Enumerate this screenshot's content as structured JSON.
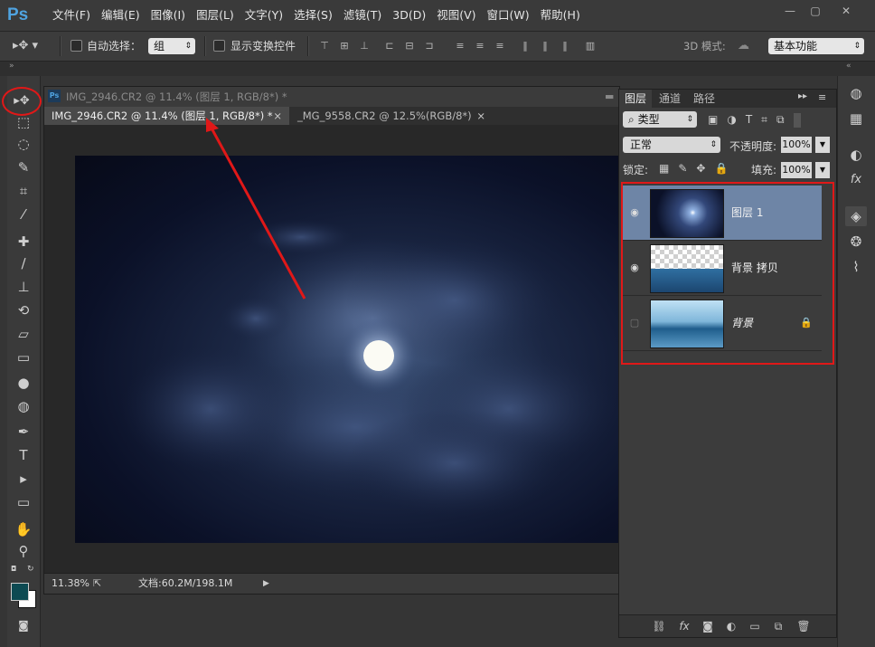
{
  "app": {
    "logo": "Ps"
  },
  "menu": [
    "文件(F)",
    "编辑(E)",
    "图像(I)",
    "图层(L)",
    "文字(Y)",
    "选择(S)",
    "滤镜(T)",
    "3D(D)",
    "视图(V)",
    "窗口(W)",
    "帮助(H)"
  ],
  "window_controls": {
    "minimize": "—",
    "maximize": "▢",
    "close": "✕"
  },
  "options": {
    "auto_select_label": "自动选择：",
    "auto_select_value": "组",
    "show_transform_label": "显示变换控件",
    "mode_3d_label": "3D 模式:",
    "workspace_value": "基本功能"
  },
  "document": {
    "window_title": "IMG_2946.CR2 @ 11.4% (图层 1, RGB/8*) *",
    "tabs": [
      {
        "label": "IMG_2946.CR2 @ 11.4% (图层 1, RGB/8*) *",
        "close": "×"
      },
      {
        "label": "_MG_9558.CR2 @ 12.5%(RGB/8*)",
        "close": "×"
      }
    ],
    "zoom": "11.38%",
    "doc_size": "文档:60.2M/198.1M"
  },
  "layers_panel": {
    "tabs": [
      "图层",
      "通道",
      "路径"
    ],
    "filter_kind": "类型",
    "blend_mode": "正常",
    "opacity_label": "不透明度:",
    "opacity_value": "100%",
    "lock_label": "锁定:",
    "fill_label": "填充:",
    "fill_value": "100%",
    "layers": [
      {
        "name": "图层 1",
        "visible": true,
        "selected": true,
        "locked": false
      },
      {
        "name": "背景 拷贝",
        "visible": true,
        "selected": false,
        "locked": false
      },
      {
        "name": "背景",
        "visible": false,
        "selected": false,
        "locked": true
      }
    ]
  },
  "colors": {
    "foreground": "#0d4a52",
    "background": "#ffffff",
    "highlight": "#e01818",
    "selected_layer": "#6e85a6"
  },
  "icons": [
    "move-tool-icon",
    "marquee-icon",
    "lasso-icon",
    "quick-select-icon",
    "crop-icon",
    "eyedropper-icon",
    "healing-brush-icon",
    "brush-icon",
    "stamp-icon",
    "history-brush-icon",
    "eraser-icon",
    "gradient-icon",
    "blur-icon",
    "dodge-icon",
    "pen-icon",
    "type-icon",
    "path-select-icon",
    "rectangle-shape-icon",
    "hand-icon",
    "zoom-icon"
  ]
}
